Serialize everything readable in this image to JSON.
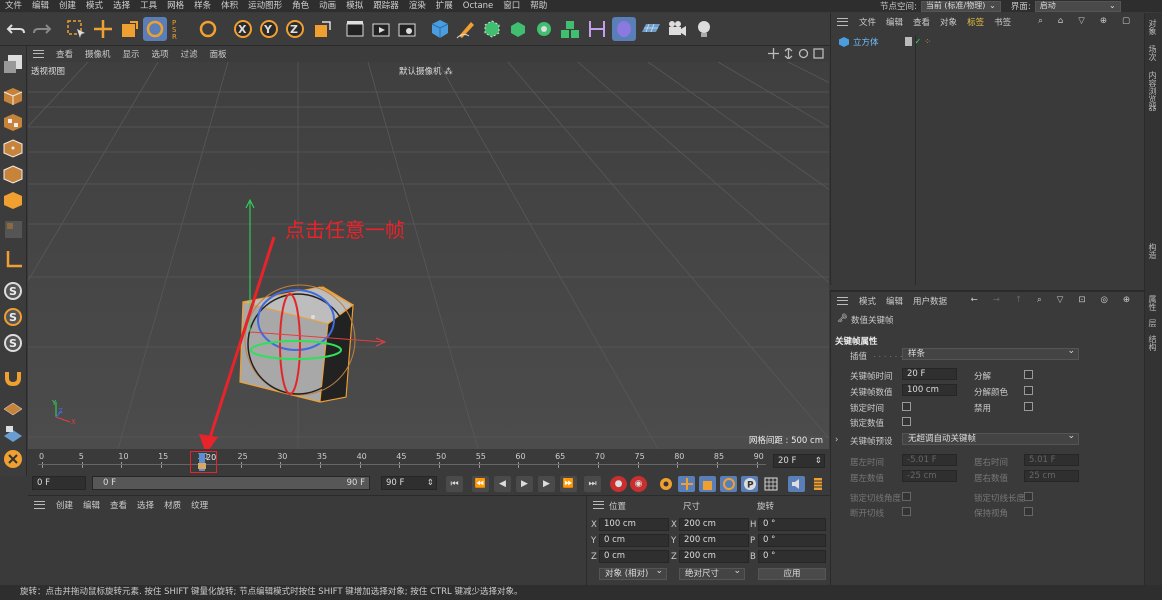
{
  "menu": [
    "文件",
    "编辑",
    "创建",
    "模式",
    "选择",
    "工具",
    "网格",
    "样条",
    "体积",
    "运动图形",
    "角色",
    "动画",
    "模拟",
    "跟踪器",
    "渲染",
    "扩展",
    "Octane",
    "窗口",
    "帮助"
  ],
  "node_space": {
    "label": "节点空间:",
    "value": "当前 (标准/物理)",
    "layout_label": "界面:",
    "layout_value": "启动"
  },
  "viewport": {
    "menu": [
      "查看",
      "摄像机",
      "显示",
      "选项",
      "过滤",
      "面板"
    ],
    "view_name": "透视视图",
    "camera_name": "默认摄像机",
    "grid_info": "网格间距 : 500 cm",
    "annotation": "点击任意一帧",
    "axis_labels": {
      "x": "X",
      "y": "Y",
      "z": "Z"
    }
  },
  "timeline": {
    "ticks": [
      "0",
      "5",
      "10",
      "15",
      "20",
      "25",
      "30",
      "35",
      "40",
      "45",
      "50",
      "55",
      "60",
      "65",
      "70",
      "75",
      "80",
      "85",
      "90"
    ],
    "current_frame_field": "20 F",
    "current_frame_marker": "20",
    "start_field": "0 F",
    "range_start": "0 F",
    "range_end": "90 F",
    "end_field": "90 F"
  },
  "material_panel": {
    "menu": [
      "创建",
      "编辑",
      "查看",
      "选择",
      "材质",
      "纹理"
    ]
  },
  "coord_panel": {
    "headers": [
      "位置",
      "尺寸",
      "旋转"
    ],
    "rows": [
      {
        "axis": "X",
        "pos": "100 cm",
        "size_axis": "X",
        "size": "200 cm",
        "rot_axis": "H",
        "rot": "0 °"
      },
      {
        "axis": "Y",
        "pos": "0 cm",
        "size_axis": "Y",
        "size": "200 cm",
        "rot_axis": "P",
        "rot": "0 °"
      },
      {
        "axis": "Z",
        "pos": "0 cm",
        "size_axis": "Z",
        "size": "200 cm",
        "rot_axis": "B",
        "rot": "0 °"
      }
    ],
    "mode_dropdown": "对象 (相对)",
    "size_dropdown": "绝对尺寸",
    "apply_button": "应用"
  },
  "object_panel": {
    "menu": [
      "文件",
      "编辑",
      "查看",
      "对象",
      "标签",
      "书签"
    ],
    "objects": [
      {
        "name": "立方体"
      }
    ]
  },
  "attr_panel": {
    "menu": [
      "模式",
      "编辑",
      "用户数据"
    ],
    "title": "数值关键帧",
    "section": "关键帧属性",
    "interp_label": "插值",
    "interp_value": "样条",
    "key_time_label": "关键帧时间",
    "key_time_value": "20 F",
    "key_value_label": "关键帧数值",
    "key_value_value": "100 cm",
    "split_label": "分解",
    "split_color_label": "分解颜色",
    "lock_time_label": "锁定时间",
    "disable_label": "禁用",
    "lock_value_label": "锁定数值",
    "preset_label": "关键帧预设",
    "preset_value": "无超调自动关键帧",
    "left_time_label": "居左时间",
    "left_time_value": "-5.01 F",
    "right_time_label": "居右时间",
    "right_time_value": "5.01 F",
    "left_value_label": "居左数值",
    "left_value_value": "-25 cm",
    "right_value_label": "居右数值",
    "right_value_value": "25 cm",
    "lock_tangent_angle": "锁定切线角度",
    "lock_tangent_length": "锁定切线长度",
    "break_tangent": "断开切线",
    "keep_view_angle": "保持视角"
  },
  "right_tabs": [
    "对象",
    "场次",
    "内容浏览器",
    "构造",
    "属性",
    "层",
    "结构"
  ],
  "status": "旋转：点击并拖动鼠标旋转元素. 按住 SHIFT 键量化旋转; 节点编辑模式时按住 SHIFT 键增加选择对象; 按住 CTRL 键减少选择对象。",
  "colors": {
    "accent": "#5a7fb8",
    "annotation": "#e8232a",
    "cube_edge": "#f0a030"
  }
}
